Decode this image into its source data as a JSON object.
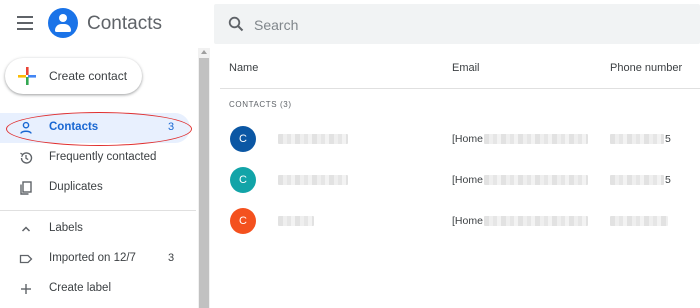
{
  "header": {
    "app_title": "Contacts",
    "search_placeholder": "Search"
  },
  "sidebar": {
    "create_label": "Create contact",
    "items": [
      {
        "label": "Contacts",
        "count": "3",
        "icon": "person-icon",
        "active": true
      },
      {
        "label": "Frequently contacted",
        "count": "",
        "icon": "history-icon",
        "active": false
      },
      {
        "label": "Duplicates",
        "count": "",
        "icon": "copy-icon",
        "active": false
      },
      {
        "label": "Labels",
        "count": "",
        "icon": "chevron-up-icon",
        "active": false
      },
      {
        "label": "Imported on 12/7",
        "count": "3",
        "icon": "label-icon",
        "active": false
      },
      {
        "label": "Create label",
        "count": "",
        "icon": "plus-icon",
        "active": false
      }
    ]
  },
  "table": {
    "columns": [
      "Name",
      "Email",
      "Phone number"
    ],
    "section_label": "CONTACTS (3)",
    "rows": [
      {
        "initial": "C",
        "avatar_color": "#0b57a4",
        "email_prefix": "[Home",
        "phone_suffix": "5"
      },
      {
        "initial": "C",
        "avatar_color": "#12a4a8",
        "email_prefix": "[Home",
        "phone_suffix": "5"
      },
      {
        "initial": "C",
        "avatar_color": "#f4511e",
        "email_prefix": "[Home",
        "phone_suffix": ""
      }
    ]
  },
  "colors": {
    "accent": "#1a73e8",
    "active_bg": "#e8f0fe",
    "highlight_ring": "#e03030"
  }
}
